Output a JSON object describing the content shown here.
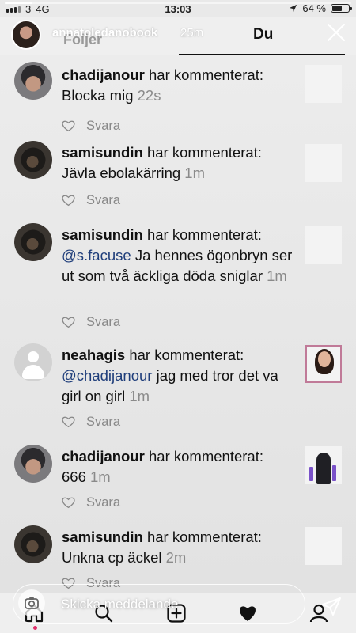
{
  "story": {
    "progress": 0.08
  },
  "status_bar": {
    "carrier": "3",
    "network": "4G",
    "time": "13:03",
    "battery_percent": "64 %",
    "battery_level": 0.64
  },
  "header": {
    "username": "annatoledanobook",
    "time_ago": "25m",
    "tab_following": "Följer",
    "tab_you": "Du"
  },
  "notifications": [
    {
      "user": "chadijanour",
      "action": " har kommenterat:",
      "mention": "",
      "text": "Blocka mig",
      "time": "22s",
      "reply_label": "Svara"
    },
    {
      "user": "samisundin",
      "action": " har kommenterat:",
      "mention": "",
      "text": "Jävla ebolakärring",
      "time": "1m",
      "reply_label": "Svara"
    },
    {
      "user": "samisundin",
      "action": " har kommenterat:",
      "mention": "@s.facuse",
      "text": " Ja hennes ögonbryn ser ut som två äckliga döda sniglar",
      "time": "1m",
      "reply_label": "Svara"
    },
    {
      "user": "neahagis",
      "action": " har kommenterat:",
      "mention": "@chadijanour",
      "text": " jag med tror det va girl on girl",
      "time": "1m",
      "reply_label": "Svara"
    },
    {
      "user": "chadijanour",
      "action": " har kommenterat:",
      "mention": "",
      "text": "666",
      "time": "1m",
      "reply_label": "Svara"
    },
    {
      "user": "samisundin",
      "action": " har kommenterat:",
      "mention": "",
      "text": "Unkna cp äckel",
      "time": "2m",
      "reply_label": "Svara"
    }
  ],
  "message_bar": {
    "placeholder": "Skicka meddelande"
  },
  "icons": {
    "camera": "camera-icon",
    "send": "send-icon",
    "home": "home-icon",
    "search": "search-icon",
    "add": "add-post-icon",
    "activity": "heart-icon",
    "profile": "profile-icon",
    "close": "close-icon"
  },
  "colors": {
    "mention": "#1e3d7a",
    "notification_dot": "#e1306c"
  }
}
